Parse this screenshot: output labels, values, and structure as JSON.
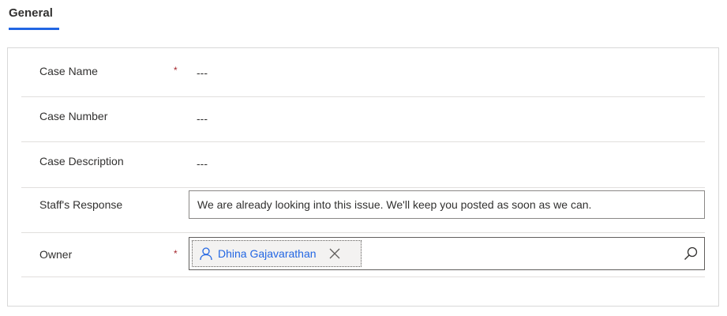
{
  "tabs": [
    {
      "label": "General",
      "selected": true
    }
  ],
  "form": {
    "case_name": {
      "label": "Case Name",
      "required": "*",
      "value": "---"
    },
    "case_number": {
      "label": "Case Number",
      "value": "---"
    },
    "case_description": {
      "label": "Case Description",
      "value": "---"
    },
    "staff_response": {
      "label": "Staff's Response",
      "value": "We are already looking into this issue. We'll keep you posted as soon as we can."
    },
    "owner": {
      "label": "Owner",
      "required": "*",
      "value": "Dhina Gajavarathan"
    }
  },
  "icons": {
    "owner_chip": "user-icon",
    "owner_remove": "close-icon",
    "owner_search": "search-icon"
  },
  "colors": {
    "accent": "#2266e3",
    "required": "#a4262c",
    "border": "#d8d8d8"
  }
}
